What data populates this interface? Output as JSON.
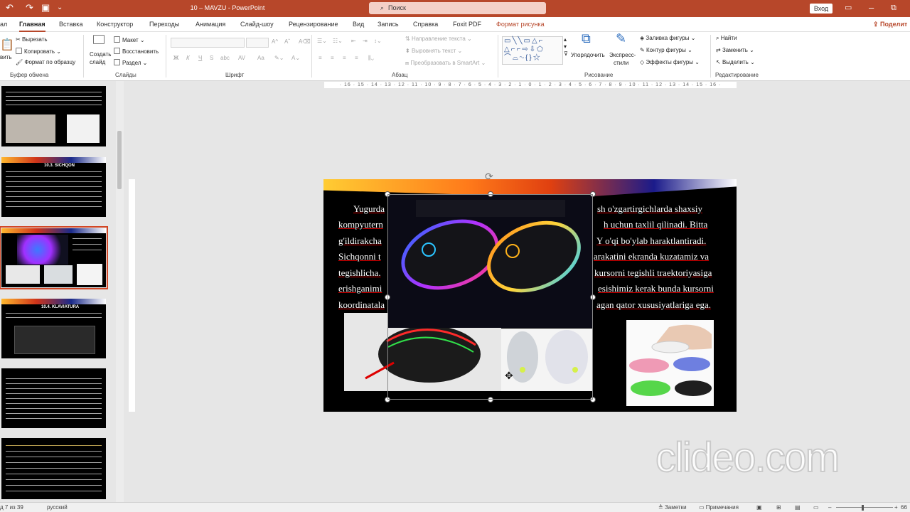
{
  "app": {
    "doc_title": "10 – MAVZU  -  PowerPoint",
    "search_placeholder": "Поиск",
    "login_label": "Вход",
    "share_label": "Поделит"
  },
  "menu": {
    "tabs": [
      "ал",
      "Главная",
      "Вставка",
      "Конструктор",
      "Переходы",
      "Анимация",
      "Слайд-шоу",
      "Рецензирование",
      "Вид",
      "Запись",
      "Справка",
      "Foxit PDF",
      "Формат рисунка"
    ],
    "active_tab": "Главная"
  },
  "ribbon": {
    "clipboard": {
      "cut": "Вырезать",
      "copy": "Копировать",
      "format_painter": "Формат по образцу",
      "paste": "вить",
      "label": "Буфер обмена"
    },
    "slides": {
      "new_slide": "Создать",
      "new_slide2": "слайд",
      "layout": "Макет",
      "reset": "Восстановить",
      "section": "Раздел",
      "label": "Слайды"
    },
    "font": {
      "label": "Шрифт",
      "bold": "Ж",
      "italic": "К",
      "underline": "Ч",
      "strike": "S",
      "shadow": "abc",
      "spacing": "AV",
      "case": "Aa"
    },
    "paragraph": {
      "text_direction": "Направление текста",
      "align_text": "Выровнять текст",
      "smartart": "Преобразовать в SmartArt",
      "label": "Абзац"
    },
    "drawing": {
      "arrange": "Упорядочить",
      "quick_styles_1": "Экспресс-",
      "quick_styles_2": "стили",
      "fill": "Заливка фигуры",
      "outline": "Контур фигуры",
      "effects": "Эффекты фигуры",
      "label": "Рисование"
    },
    "editing": {
      "find": "Найти",
      "replace": "Заменить",
      "select": "Выделить",
      "label": "Редактирование"
    }
  },
  "thumbnails": [
    {
      "title": ""
    },
    {
      "title": "10.3. SICHQON"
    },
    {
      "title": ""
    },
    {
      "title": "10.4. KLAVIATURA"
    },
    {
      "title": ""
    },
    {
      "title": ""
    }
  ],
  "ruler": {
    "horizontal": "· 16 · 15 · 14 · 13 · 12 · 11 · 10 · 9 · 8 · 7 · 6 · 5 · 4 · 3 · 2 · 1 · 0 · 1 · 2 · 3 · 4 · 5 · 6 · 7 · 8 · 9 · 10 · 11 · 12 · 13 · 14 · 15 · 16 ·"
  },
  "slide": {
    "lines": [
      {
        "left": "Yugurda",
        "right": "sh  o'zgartirgichlarda  shaxsiy"
      },
      {
        "left": "kompyutern",
        "right": "h  uchun  taxlil  qilinadi.  Bitta"
      },
      {
        "left": "g'ildirakcha",
        "right": "Y  o'qi  bo'ylab  haraktlantiradi."
      },
      {
        "left": "Sichqonni  t",
        "right": "arakatini  ekranda  kuzatamiz  va"
      },
      {
        "left": "tegishlicha.",
        "right": "kursorni  tegishli  traektoriyasiga"
      },
      {
        "left": "erishganimi",
        "right": "esishimiz  kerak  bunda  kursorni"
      },
      {
        "left": "koordinatala",
        "right": "agan qator xususiyatlariga ega."
      }
    ]
  },
  "status": {
    "slide_counter": "д 7 из 39",
    "language": "русский",
    "notes": "Заметки",
    "comments": "Примечания",
    "zoom": "66"
  },
  "watermark": "clideo.com",
  "colors": {
    "accent": "#b7472a",
    "selection": "#d24726"
  }
}
